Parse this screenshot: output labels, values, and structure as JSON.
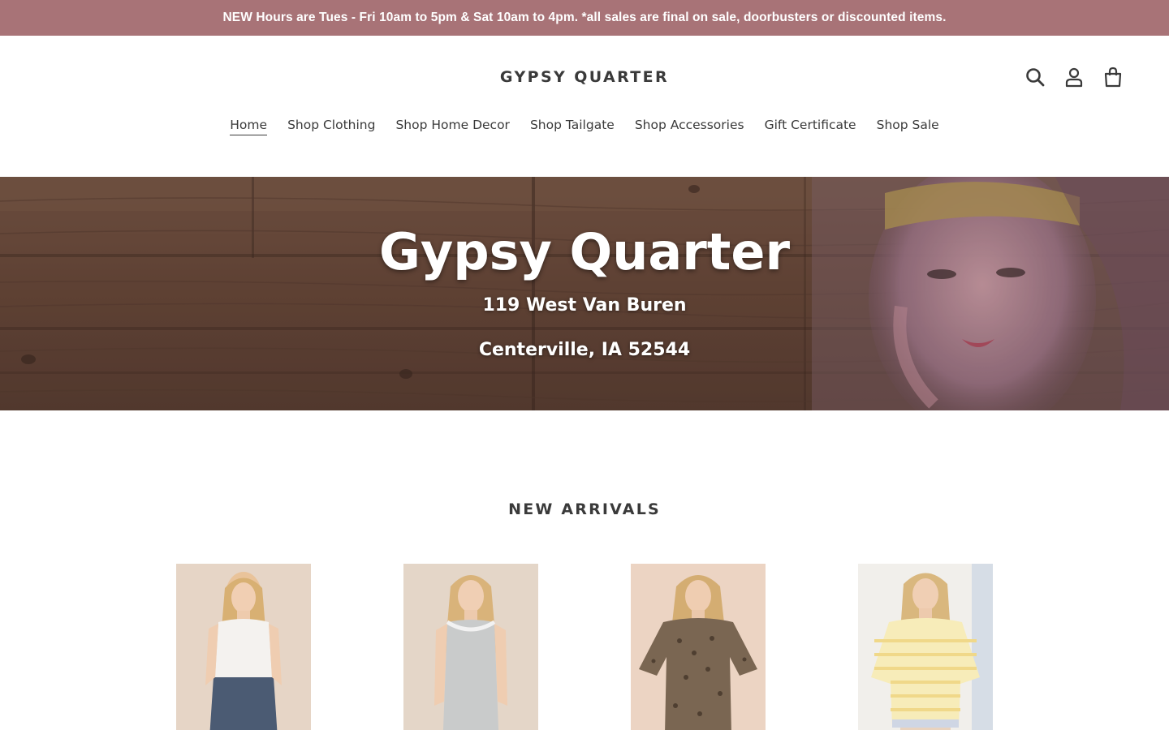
{
  "announcement": "NEW Hours are Tues - Fri 10am to 5pm & Sat 10am to 4pm. *all sales are final on sale, doorbusters or discounted items.",
  "header": {
    "logo": "GYPSY QUARTER",
    "icons": [
      "search-icon",
      "account-icon",
      "cart-icon"
    ]
  },
  "nav": {
    "items": [
      {
        "label": "Home",
        "active": true
      },
      {
        "label": "Shop Clothing"
      },
      {
        "label": "Shop Home Decor"
      },
      {
        "label": "Shop Tailgate"
      },
      {
        "label": "Shop Accessories"
      },
      {
        "label": "Gift Certificate"
      },
      {
        "label": "Shop Sale"
      }
    ]
  },
  "hero": {
    "title": "Gypsy Quarter",
    "address_line1": "119 West Van Buren",
    "address_line2": "Centerville, IA 52544"
  },
  "new_arrivals": {
    "title": "NEW ARRIVALS",
    "products": [
      {
        "image": "white ribbed tank top with denim shorts"
      },
      {
        "image": "grey striped tank top"
      },
      {
        "image": "leopard print short sleeve top"
      },
      {
        "image": "yellow striped short sleeve sweater"
      }
    ]
  },
  "colors": {
    "announcement_bg": "#a87377",
    "text": "#3a3a3a",
    "background": "#ffffff"
  }
}
